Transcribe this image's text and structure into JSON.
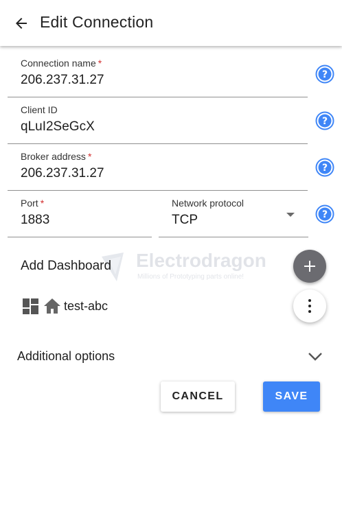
{
  "appbar": {
    "title": "Edit Connection"
  },
  "form": {
    "connection_name": {
      "label": "Connection name",
      "required_mark": "*",
      "value": "206.237.31.27"
    },
    "client_id": {
      "label": "Client ID",
      "value": "qLuI2SeGcX"
    },
    "broker_address": {
      "label": "Broker address",
      "required_mark": "*",
      "value": "206.237.31.27"
    },
    "port": {
      "label": "Port",
      "required_mark": "*",
      "value": "1883"
    },
    "network_protocol": {
      "label": "Network protocol",
      "value": "TCP"
    }
  },
  "dashboard": {
    "section_label": "Add Dashboard",
    "items": [
      {
        "label": "test-abc",
        "icons": [
          "dashboard-icon",
          "home-icon"
        ]
      }
    ]
  },
  "watermark": {
    "title": "Electrodragon",
    "subtitle": "Millions of Prototyping parts online!"
  },
  "additional_options": {
    "label": "Additional options"
  },
  "actions": {
    "cancel_label": "CANCEL",
    "save_label": "SAVE"
  },
  "colors": {
    "accent": "#3f86f7",
    "help_icon": "#3f86f7",
    "required": "#d32f2f",
    "fab": "#6b6b70"
  }
}
